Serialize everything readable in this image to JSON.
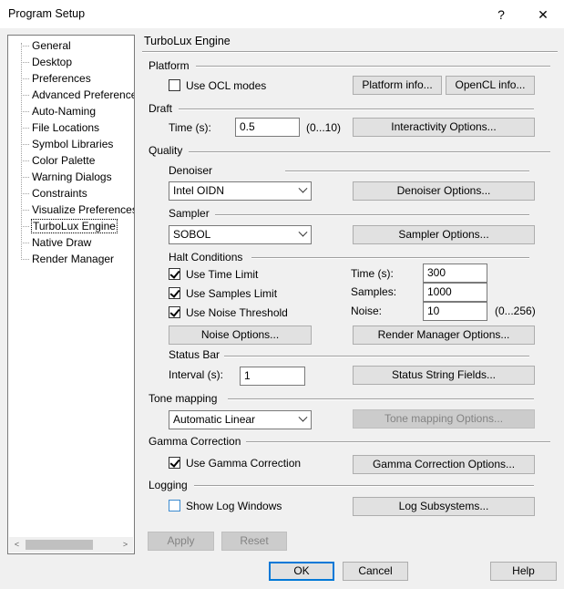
{
  "window": {
    "title": "Program Setup",
    "help_glyph": "?",
    "close_glyph": "✕"
  },
  "tree": {
    "items": [
      {
        "label": "General"
      },
      {
        "label": "Desktop"
      },
      {
        "label": "Preferences"
      },
      {
        "label": "Advanced Preferences"
      },
      {
        "label": "Auto-Naming"
      },
      {
        "label": "File Locations"
      },
      {
        "label": "Symbol Libraries"
      },
      {
        "label": "Color Palette"
      },
      {
        "label": "Warning Dialogs"
      },
      {
        "label": "Constraints"
      },
      {
        "label": "Visualize Preferences"
      },
      {
        "label": "TurboLux Engine",
        "selected": true
      },
      {
        "label": "Native Draw"
      },
      {
        "label": "Render Manager"
      }
    ],
    "scroll_left_glyph": "<",
    "scroll_right_glyph": ">"
  },
  "panel": {
    "title": "TurboLux Engine",
    "platform": {
      "label": "Platform",
      "use_ocl_label": "Use OCL modes",
      "use_ocl_checked": false,
      "platform_info_btn": "Platform info...",
      "opencl_info_btn": "OpenCL info..."
    },
    "draft": {
      "label": "Draft",
      "time_label": "Time (s):",
      "time_value": "0.5",
      "time_range": "(0...10)",
      "interactivity_btn": "Interactivity Options..."
    },
    "quality": {
      "label": "Quality",
      "denoiser_label": "Denoiser",
      "denoiser_value": "Intel OIDN",
      "denoiser_btn": "Denoiser Options...",
      "sampler_label": "Sampler",
      "sampler_value": "SOBOL",
      "sampler_btn": "Sampler Options...",
      "halt_label": "Halt Conditions",
      "use_time_limit": "Use Time Limit",
      "use_samples_limit": "Use Samples Limit",
      "use_noise_threshold": "Use Noise Threshold",
      "time_label": "Time (s):",
      "time_value": "300",
      "samples_label": "Samples:",
      "samples_value": "1000",
      "noise_label": "Noise:",
      "noise_value": "10",
      "noise_range": "(0...256)",
      "noise_btn": "Noise Options...",
      "render_manager_btn": "Render Manager Options...",
      "status_bar_label": "Status Bar",
      "interval_label": "Interval (s):",
      "interval_value": "1",
      "status_fields_btn": "Status String Fields..."
    },
    "tone_mapping": {
      "label": "Tone mapping",
      "value": "Automatic Linear",
      "options_btn": "Tone mapping Options..."
    },
    "gamma": {
      "label": "Gamma Correction",
      "use_label": "Use Gamma Correction",
      "options_btn": "Gamma Correction Options..."
    },
    "logging": {
      "label": "Logging",
      "show_label": "Show Log Windows",
      "subsystems_btn": "Log Subsystems..."
    },
    "apply_btn": "Apply",
    "reset_btn": "Reset"
  },
  "footer": {
    "ok_btn": "OK",
    "cancel_btn": "Cancel",
    "help_btn": "Help"
  },
  "colors": {
    "focus_blue": "#0078d7",
    "checkbox_blue": "#3c8bd0"
  }
}
